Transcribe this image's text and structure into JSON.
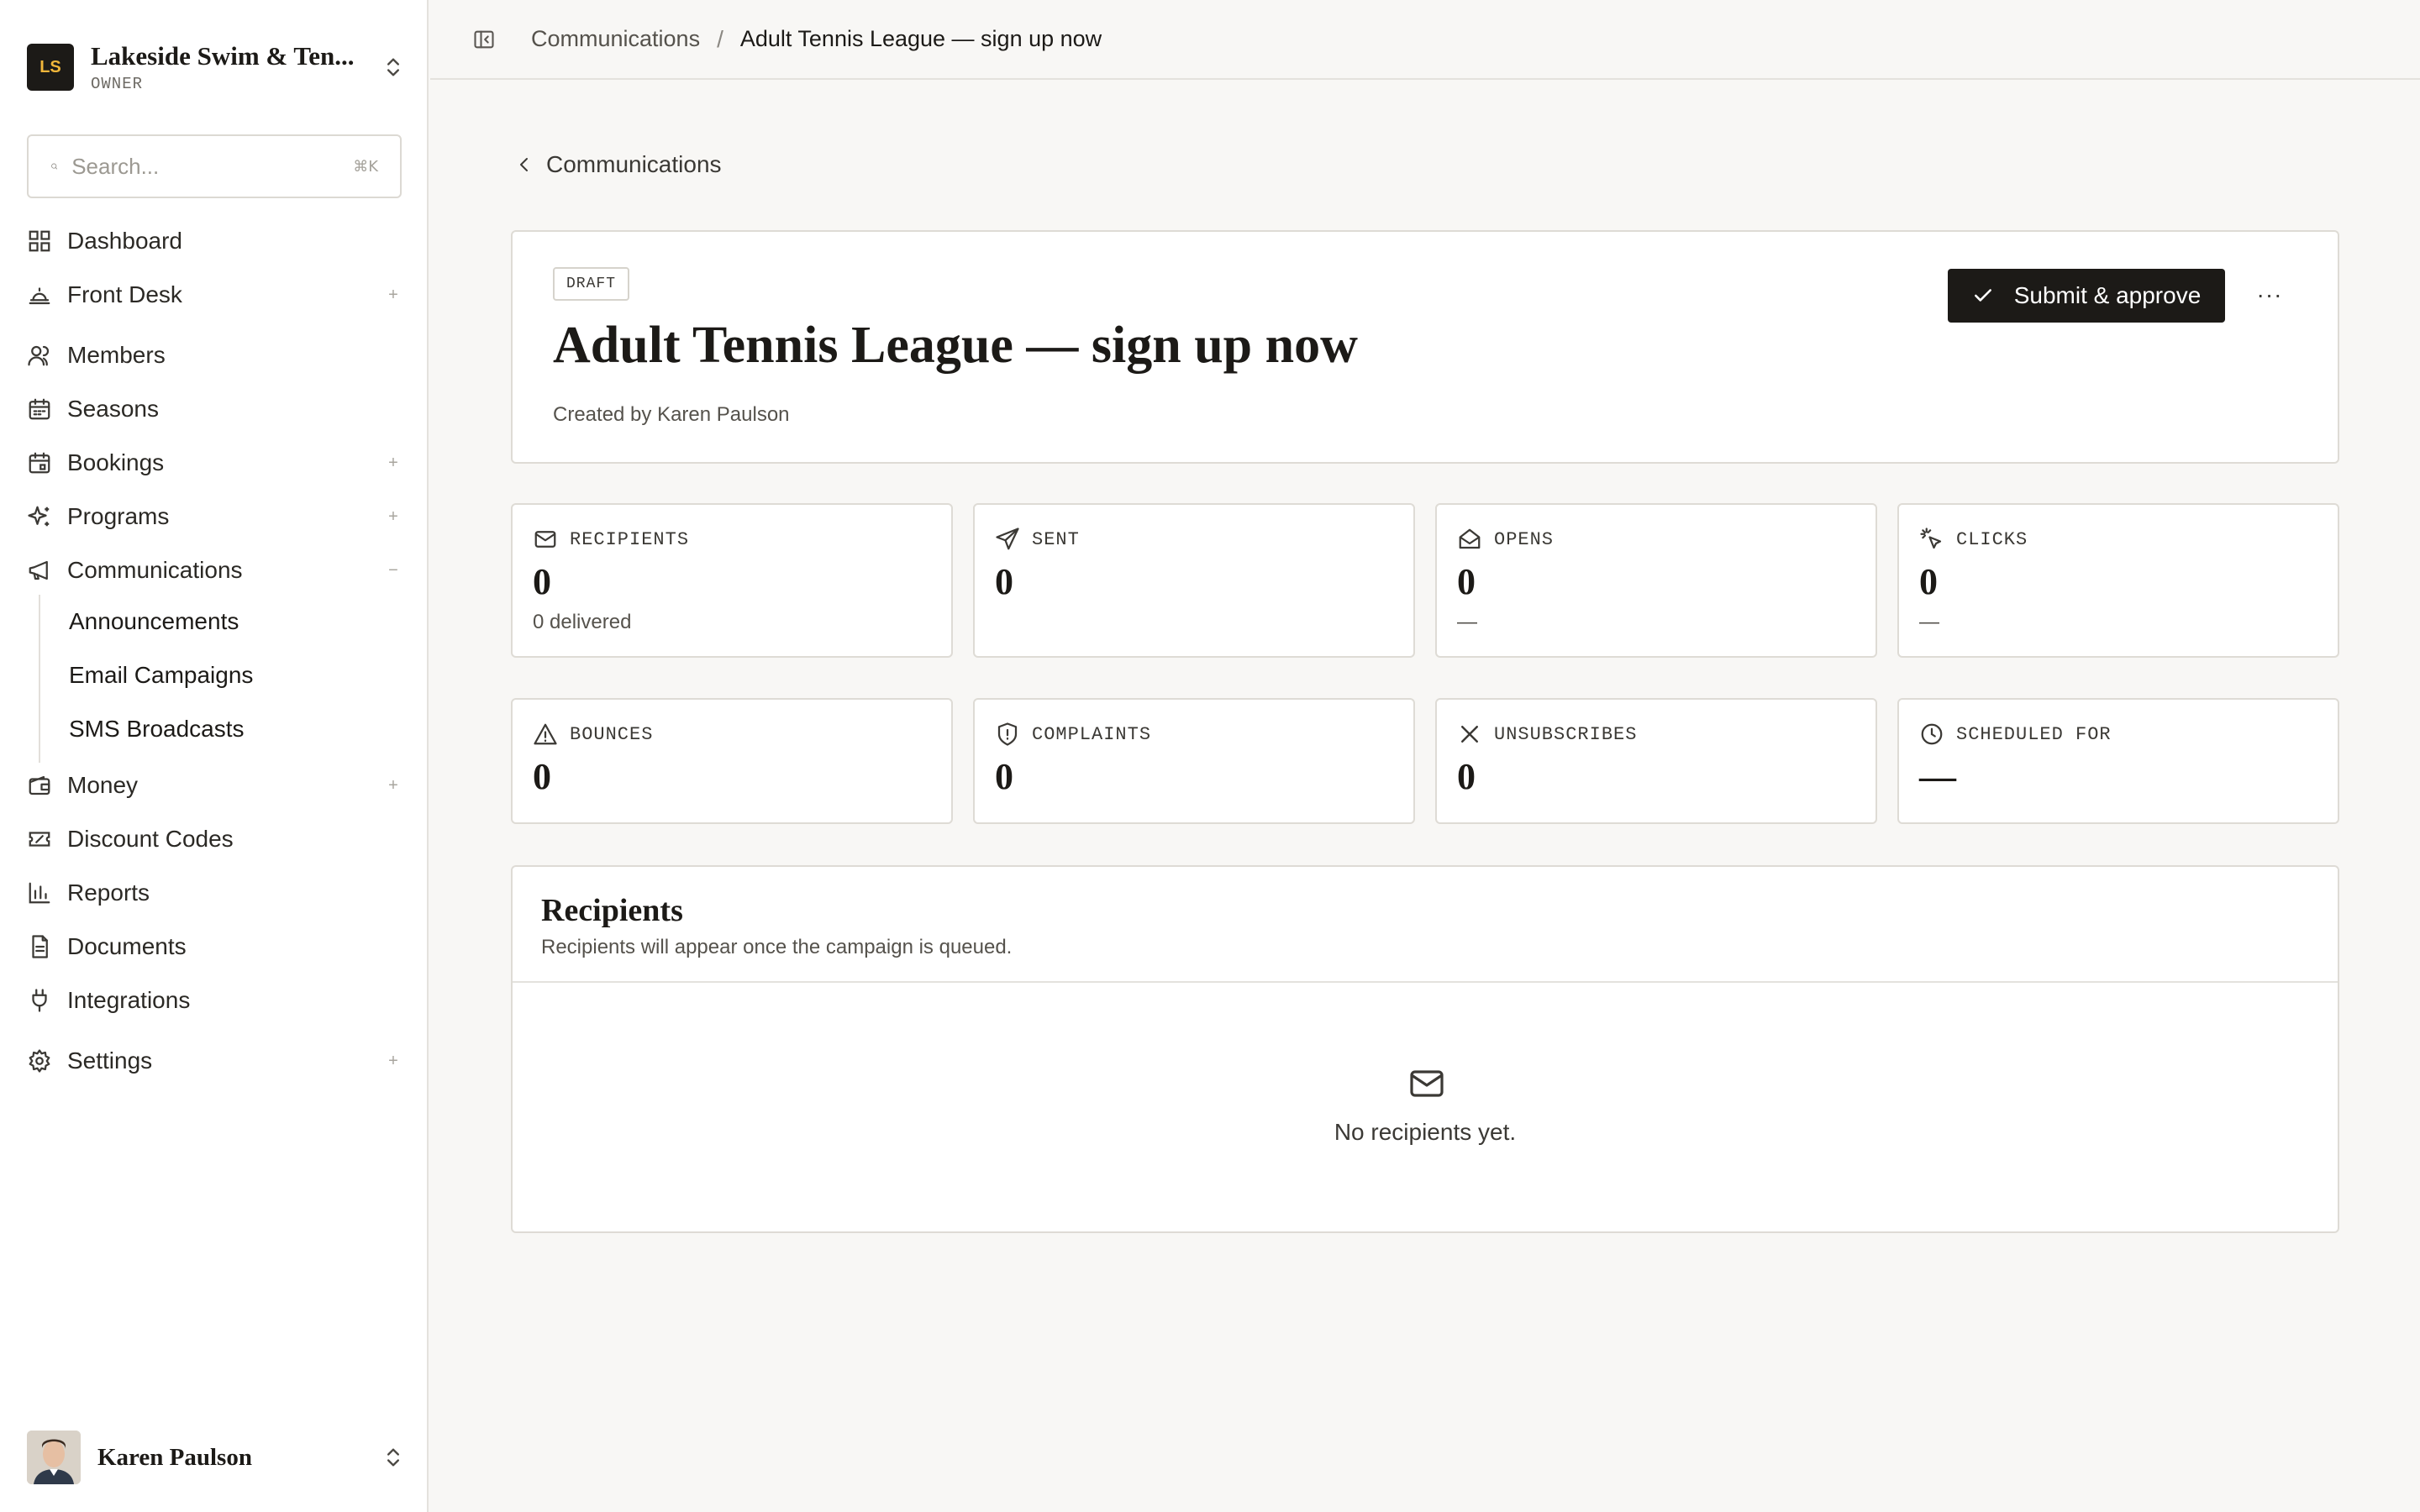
{
  "org": {
    "initials": "LS",
    "name": "Lakeside Swim & Ten...",
    "role": "OWNER"
  },
  "search": {
    "placeholder": "Search...",
    "shortcut": "⌘K"
  },
  "nav": {
    "items": [
      {
        "label": "Dashboard",
        "icon": "dashboard-icon",
        "toggle": ""
      },
      {
        "label": "Front Desk",
        "icon": "bell-icon",
        "toggle": "+"
      },
      {
        "label": "Members",
        "icon": "users-icon",
        "toggle": ""
      },
      {
        "label": "Seasons",
        "icon": "calendar-grid-icon",
        "toggle": ""
      },
      {
        "label": "Bookings",
        "icon": "calendar-icon",
        "toggle": "+"
      },
      {
        "label": "Programs",
        "icon": "sparkles-icon",
        "toggle": "+"
      },
      {
        "label": "Communications",
        "icon": "megaphone-icon",
        "toggle": "−"
      },
      {
        "label": "Money",
        "icon": "wallet-icon",
        "toggle": "+"
      },
      {
        "label": "Discount Codes",
        "icon": "ticket-icon",
        "toggle": ""
      },
      {
        "label": "Reports",
        "icon": "bar-chart-icon",
        "toggle": ""
      },
      {
        "label": "Documents",
        "icon": "document-icon",
        "toggle": ""
      },
      {
        "label": "Integrations",
        "icon": "plug-icon",
        "toggle": ""
      },
      {
        "label": "Settings",
        "icon": "gear-icon",
        "toggle": "+"
      }
    ],
    "sub_items": [
      {
        "label": "Announcements"
      },
      {
        "label": "Email Campaigns"
      },
      {
        "label": "SMS Broadcasts"
      }
    ]
  },
  "user": {
    "name": "Karen Paulson"
  },
  "breadcrumb": {
    "parent": "Communications",
    "separator": "/",
    "current": "Adult Tennis League — sign up now"
  },
  "back_link": "Communications",
  "campaign": {
    "status": "DRAFT",
    "title": "Adult Tennis League — sign up now",
    "created_by": "Created by Karen Paulson",
    "primary_action": "Submit & approve",
    "more_label": "···"
  },
  "stats": [
    {
      "label": "RECIPIENTS",
      "value": "0",
      "sub": "0 delivered",
      "icon": "mail-icon"
    },
    {
      "label": "SENT",
      "value": "0",
      "sub": "",
      "icon": "send-icon"
    },
    {
      "label": "OPENS",
      "value": "0",
      "sub": "—",
      "icon": "mail-open-icon"
    },
    {
      "label": "CLICKS",
      "value": "0",
      "sub": "—",
      "icon": "cursor-click-icon"
    },
    {
      "label": "BOUNCES",
      "value": "0",
      "sub": "",
      "icon": "warning-icon"
    },
    {
      "label": "COMPLAINTS",
      "value": "0",
      "sub": "",
      "icon": "shield-icon"
    },
    {
      "label": "UNSUBSCRIBES",
      "value": "0",
      "sub": "",
      "icon": "close-icon"
    },
    {
      "label": "SCHEDULED FOR",
      "value": "—",
      "sub": "",
      "icon": "clock-icon"
    }
  ],
  "recipients": {
    "title": "Recipients",
    "subtitle": "Recipients will appear once the campaign is queued.",
    "empty_text": "No recipients yet."
  },
  "colors": {
    "accent": "#1c1a17",
    "logo_text": "#f0b63a",
    "background": "#f8f7f5",
    "card": "#ffffff",
    "border": "#dedbd5"
  }
}
